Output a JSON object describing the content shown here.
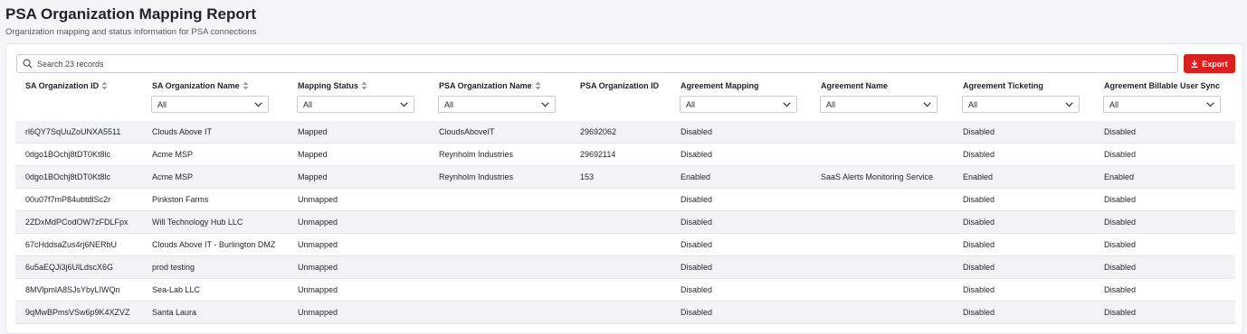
{
  "header": {
    "title": "PSA Organization Mapping Report",
    "subtitle": "Organization mapping and status information for PSA connections"
  },
  "search": {
    "placeholder": "Search 23 records"
  },
  "export": {
    "label": "Export"
  },
  "columns": [
    {
      "label": "SA Organization ID",
      "sortable": true,
      "filter": null
    },
    {
      "label": "SA Organization Name",
      "sortable": true,
      "filter": "All"
    },
    {
      "label": "Mapping Status",
      "sortable": true,
      "filter": "All"
    },
    {
      "label": "PSA Organization Name",
      "sortable": true,
      "filter": "All"
    },
    {
      "label": "PSA Organization ID",
      "sortable": false,
      "filter": null
    },
    {
      "label": "Agreement Mapping",
      "sortable": false,
      "filter": "All"
    },
    {
      "label": "Agreement Name",
      "sortable": false,
      "filter": "All"
    },
    {
      "label": "Agreement Ticketing",
      "sortable": false,
      "filter": "All"
    },
    {
      "label": "Agreement Billable User Sync",
      "sortable": false,
      "filter": "All"
    }
  ],
  "rows": [
    [
      "rl6QY7SqUuZoUNXA5511",
      "Clouds Above IT",
      "Mapped",
      "CloudsAboveIT",
      "29692062",
      "Disabled",
      "",
      "Disabled",
      "Disabled"
    ],
    [
      "0dgo1BOchj8tDT0Kt8lc",
      "Acme MSP",
      "Mapped",
      "Reynholm Industries",
      "29692114",
      "Disabled",
      "",
      "Disabled",
      "Disabled"
    ],
    [
      "0dgo1BOchj8tDT0Kt8lc",
      "Acme MSP",
      "Mapped",
      "Reynholm Industries",
      "153",
      "Enabled",
      "SaaS Alerts Monitoring Service",
      "Enabled",
      "Enabled"
    ],
    [
      "00u07f7mP84ubtdlSc2r",
      "Pinkston Farms",
      "Unmapped",
      "",
      "",
      "Disabled",
      "",
      "Disabled",
      "Disabled"
    ],
    [
      "2ZDxMdPCodOW7zFDLFpx",
      "Will Technology Hub LLC",
      "Unmapped",
      "",
      "",
      "Disabled",
      "",
      "Disabled",
      "Disabled"
    ],
    [
      "67cHddsaZus4rj6NERbU",
      "Clouds Above IT - Burlington DMZ",
      "Unmapped",
      "",
      "",
      "Disabled",
      "",
      "Disabled",
      "Disabled"
    ],
    [
      "6u5aEQJi3j6UlLdscX6G",
      "prod testing",
      "Unmapped",
      "",
      "",
      "Disabled",
      "",
      "Disabled",
      "Disabled"
    ],
    [
      "8MVlpmlA8SJsYbyLIWQn",
      "Sea-Lab LLC",
      "Unmapped",
      "",
      "",
      "Disabled",
      "",
      "Disabled",
      "Disabled"
    ],
    [
      "9qMwBPmsVSw6p9K4XZVZ",
      "Santa Laura",
      "Unmapped",
      "",
      "",
      "Disabled",
      "",
      "Disabled",
      "Disabled"
    ]
  ],
  "colors": {
    "accent": "#d92020",
    "row_alt": "#f2f3f4"
  }
}
